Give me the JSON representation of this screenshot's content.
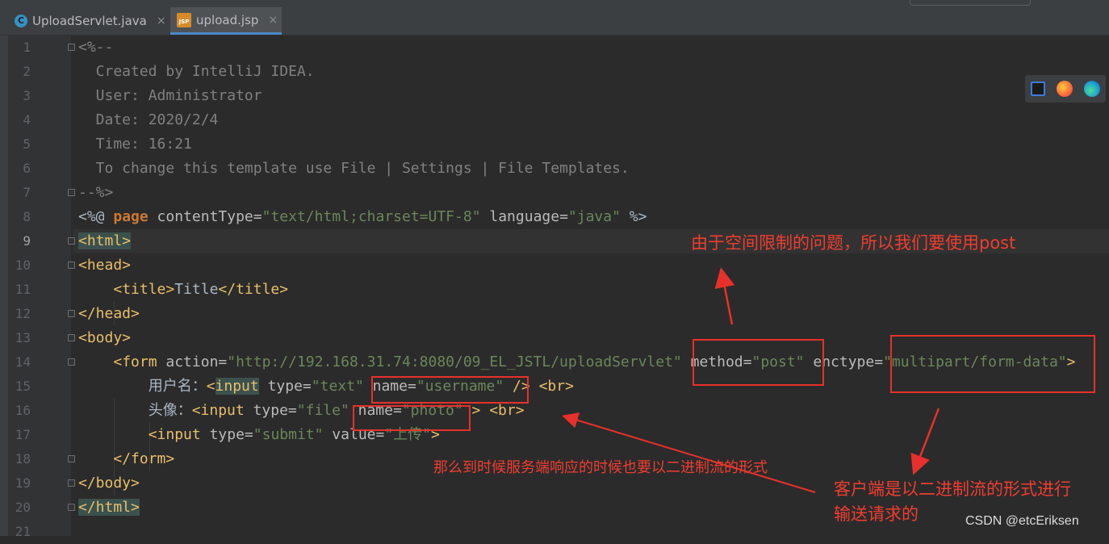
{
  "tabs": [
    {
      "label": "UploadServlet.java",
      "icon": "java-class-icon",
      "active": false
    },
    {
      "label": "upload.jsp",
      "icon": "jsp-file-icon",
      "active": true
    }
  ],
  "close_glyph": "×",
  "line_numbers": [
    "1",
    "2",
    "3",
    "4",
    "5",
    "6",
    "7",
    "8",
    "9",
    "10",
    "11",
    "12",
    "13",
    "14",
    "15",
    "16",
    "17",
    "18",
    "19",
    "20",
    "21"
  ],
  "current_line": 9,
  "code": {
    "l1": "<%--",
    "l2": "  Created by IntelliJ IDEA.",
    "l3": "  User: Administrator",
    "l4": "  Date: 2020/2/4",
    "l5": "  Time: 16:21",
    "l6": "  To change this template use File | Settings | File Templates.",
    "l7": "--%>",
    "l8": {
      "open": "<%@ ",
      "kw": "page",
      "a1": " contentType=",
      "v1": "\"text/html;charset=UTF-8\"",
      "a2": " language=",
      "v2": "\"java\"",
      "close": " %>"
    },
    "l9": "<html>",
    "l10": "<head>",
    "l11": {
      "indent": "    ",
      "o": "<title>",
      "t": "Title",
      "c": "</title>"
    },
    "l12": "</head>",
    "l13": "<body>",
    "l14": {
      "indent": "    ",
      "o": "<form",
      "a1": " action=",
      "v1": "\"http://192.168.31.74:8080/09_EL_JSTL/uploadServlet\"",
      "a2": " method=",
      "v2": "\"post\"",
      "a3": " enctype=",
      "v3": "\"multipart/form-data\"",
      "c": ">"
    },
    "l15": {
      "indent": "        ",
      "label": "用户名：",
      "o": "<",
      "tagname": "input",
      "a1": " type=",
      "v1": "\"text\"",
      "a2": " name=",
      "v2": "\"username\"",
      "c": " /> ",
      "br": "<br>"
    },
    "l16": {
      "indent": "        ",
      "label": "头像：",
      "o": "<input",
      "a1": " type=",
      "v1": "\"file\"",
      "a2": " name=",
      "v2": "\"photo\"",
      "c": " > ",
      "br": "<br>"
    },
    "l17": {
      "indent": "        ",
      "o": "<input",
      "a1": " type=",
      "v1": "\"submit\"",
      "a2": " value=",
      "v2": "\"上传\"",
      "c": ">"
    },
    "l18": {
      "indent": "    ",
      "t": "</form>"
    },
    "l19": "</body>",
    "l20": "</html>"
  },
  "annotations": {
    "post_note": "由于空间限制的问题，所以我们要使用post",
    "response_note": "那么到时候服务端响应的时候也要以二进制流的形式",
    "client_note_1": "客户端是以二进制流的形式进行",
    "client_note_2": "输送请求的"
  },
  "watermark": "CSDN @etcEriksen",
  "browser_icons": [
    "intellij-icon",
    "firefox-icon",
    "edge-icon"
  ],
  "colors": {
    "annotation": "#e8302a",
    "tag": "#e8bf6a",
    "string": "#6a8759",
    "comment": "#808080",
    "keyword": "#cc7832"
  }
}
